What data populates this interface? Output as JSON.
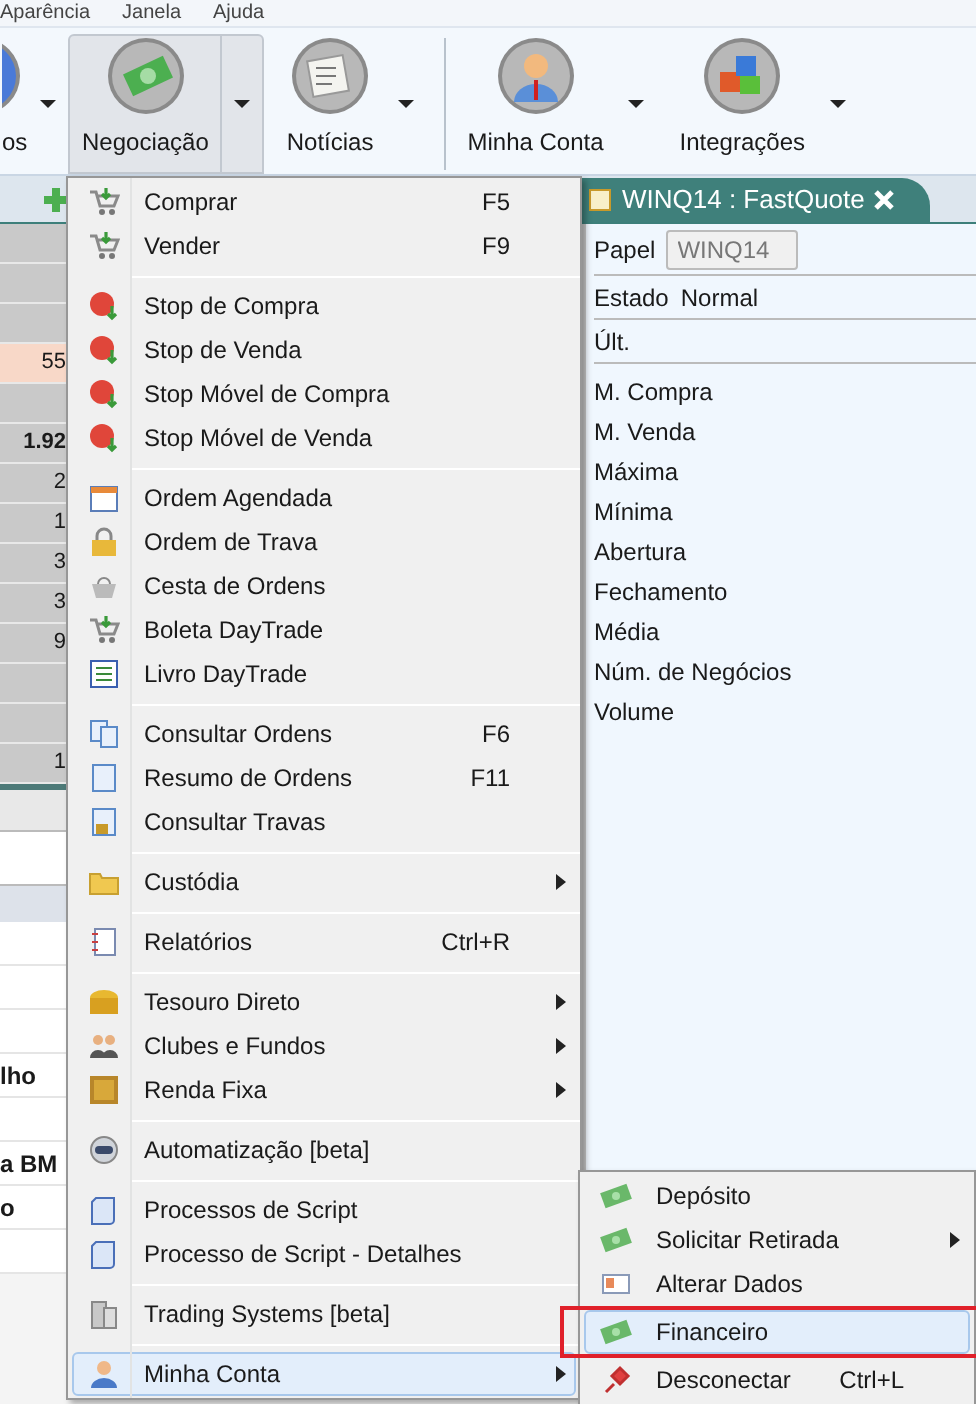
{
  "menubar": [
    "Aparência",
    "Janela",
    "Ajuda"
  ],
  "toolbar": [
    {
      "label": "os",
      "pressed": false
    },
    {
      "label": "Negociação",
      "pressed": true
    },
    {
      "label": "Notícias",
      "pressed": false
    },
    {
      "label": "Minha Conta",
      "pressed": false
    },
    {
      "label": "Integrações",
      "pressed": false
    }
  ],
  "quote_tab": {
    "title": "WINQ14 : FastQuote"
  },
  "left_table": {
    "rows": [
      {
        "highlighted": false
      },
      {
        "highlighted": false
      },
      {
        "highlighted": false
      },
      {
        "value": "55",
        "highlighted": true
      },
      {
        "highlighted": false
      },
      {
        "value": "1.92",
        "highlighted": false
      },
      {
        "value": "2",
        "highlighted": false
      },
      {
        "value": "1",
        "highlighted": false
      },
      {
        "value": "3",
        "highlighted": false
      },
      {
        "value": "3",
        "highlighted": false
      },
      {
        "value": "9",
        "highlighted": false
      },
      {
        "highlighted": false
      },
      {
        "highlighted": false
      },
      {
        "value": "1",
        "highlighted": false
      }
    ]
  },
  "left_list": {
    "rows": [
      {},
      {},
      {},
      {
        "value": "lho"
      },
      {},
      {
        "value": "a BM"
      },
      {
        "value": "o"
      },
      {}
    ]
  },
  "fastquote": {
    "papel_label": "Papel",
    "papel_value": "WINQ14",
    "estado_label": "Estado",
    "estado_value": "Normal",
    "ult_label": "Últ.",
    "fields": [
      "M. Compra",
      "M. Venda",
      "Máxima",
      "Mínima",
      "Abertura",
      "Fechamento",
      "Média",
      "Núm. de Negócios",
      "Volume"
    ]
  },
  "menu": {
    "groups": [
      [
        {
          "label": "Comprar",
          "shortcut": "F5",
          "submenu": false,
          "selected": false
        },
        {
          "label": "Vender",
          "shortcut": "F9",
          "submenu": false,
          "selected": false
        }
      ],
      [
        {
          "label": "Stop de Compra",
          "submenu": false,
          "selected": false
        },
        {
          "label": "Stop de Venda",
          "submenu": false,
          "selected": false
        },
        {
          "label": "Stop Móvel de Compra",
          "submenu": false,
          "selected": false
        },
        {
          "label": "Stop Móvel de Venda",
          "submenu": false,
          "selected": false
        }
      ],
      [
        {
          "label": "Ordem Agendada",
          "submenu": false,
          "selected": false
        },
        {
          "label": "Ordem de Trava",
          "submenu": false,
          "selected": false
        },
        {
          "label": "Cesta de Ordens",
          "submenu": false,
          "selected": false
        },
        {
          "label": "Boleta DayTrade",
          "submenu": false,
          "selected": false
        },
        {
          "label": "Livro DayTrade",
          "submenu": false,
          "selected": false
        }
      ],
      [
        {
          "label": "Consultar Ordens",
          "shortcut": "F6",
          "submenu": false,
          "selected": false
        },
        {
          "label": "Resumo de Ordens",
          "shortcut": "F11",
          "submenu": false,
          "selected": false
        },
        {
          "label": "Consultar Travas",
          "submenu": false,
          "selected": false
        }
      ],
      [
        {
          "label": "Custódia",
          "submenu": true,
          "selected": false
        }
      ],
      [
        {
          "label": "Relatórios",
          "shortcut": "Ctrl+R",
          "submenu": false,
          "selected": false
        }
      ],
      [
        {
          "label": "Tesouro Direto",
          "submenu": true,
          "selected": false
        },
        {
          "label": "Clubes e Fundos",
          "submenu": true,
          "selected": false
        },
        {
          "label": "Renda Fixa",
          "submenu": true,
          "selected": false
        }
      ],
      [
        {
          "label": "Automatização [beta]",
          "submenu": false,
          "selected": false
        }
      ],
      [
        {
          "label": "Processos de Script",
          "submenu": false,
          "selected": false
        },
        {
          "label": "Processo de Script - Detalhes",
          "submenu": false,
          "selected": false
        }
      ],
      [
        {
          "label": "Trading Systems [beta]",
          "submenu": false,
          "selected": false
        }
      ],
      [
        {
          "label": "Minha Conta",
          "submenu": true,
          "selected": true
        }
      ]
    ]
  },
  "submenu": {
    "items": [
      {
        "label": "Depósito",
        "submenu": false,
        "selected": false,
        "outlined": false
      },
      {
        "label": "Solicitar Retirada",
        "submenu": true,
        "selected": false,
        "outlined": false
      },
      {
        "label": "Alterar Dados",
        "submenu": false,
        "selected": false,
        "outlined": false
      },
      {
        "label": "Financeiro",
        "submenu": false,
        "selected": true,
        "outlined": true
      },
      {
        "label": "Desconectar",
        "shortcut": "Ctrl+L",
        "submenu": false,
        "selected": false,
        "outlined": false
      }
    ]
  }
}
